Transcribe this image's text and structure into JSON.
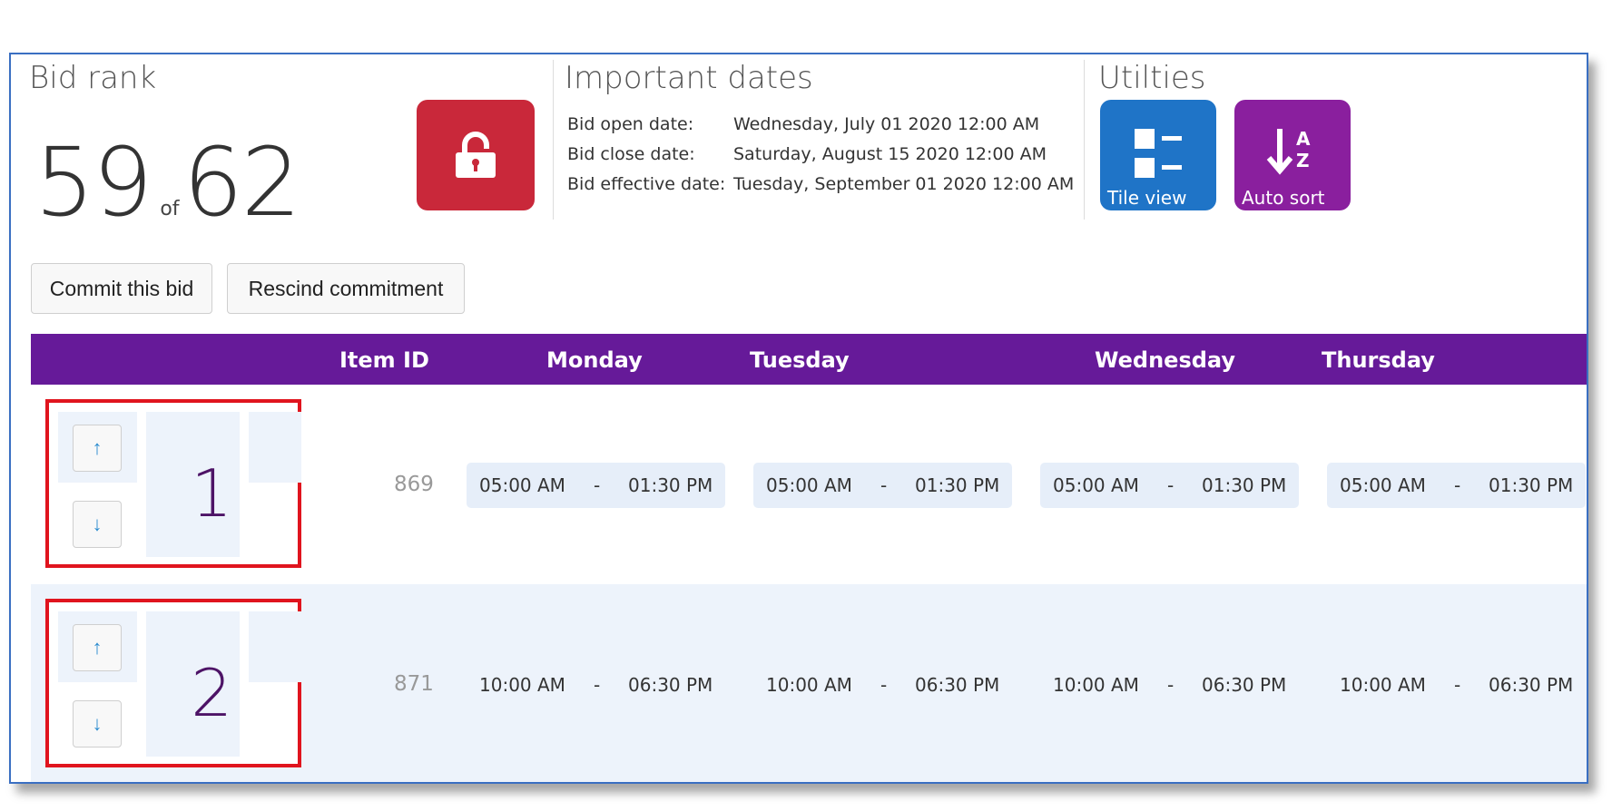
{
  "header": {
    "bid_rank": {
      "title": "Bid rank",
      "rank": "59",
      "of": "of",
      "total": "62"
    },
    "important_dates": {
      "title": "Important dates",
      "items": [
        {
          "label": "Bid open date:",
          "value": "Wednesday, July 01 2020 12:00 AM"
        },
        {
          "label": "Bid close date:",
          "value": "Saturday, August 15 2020 12:00 AM"
        },
        {
          "label": "Bid effective date:",
          "value": "Tuesday, September 01 2020 12:00 AM"
        }
      ]
    },
    "utilities": {
      "title": "Utilties",
      "tile_view": "Tile view",
      "auto_sort": "Auto sort",
      "sort_glyph_a": "A",
      "sort_glyph_z": "Z"
    }
  },
  "actions": {
    "commit": "Commit this bid",
    "rescind": "Rescind commitment"
  },
  "table": {
    "columns": [
      "Item ID",
      "Monday",
      "Tuesday",
      "Wednesday",
      "Thursday"
    ],
    "separator": "-",
    "rows": [
      {
        "rank": "1",
        "item_id": "869",
        "shifts": [
          {
            "start": "05:00 AM",
            "end": "01:30 PM"
          },
          {
            "start": "05:00 AM",
            "end": "01:30 PM"
          },
          {
            "start": "05:00 AM",
            "end": "01:30 PM"
          },
          {
            "start": "05:00 AM",
            "end": "01:30 PM"
          }
        ]
      },
      {
        "rank": "2",
        "item_id": "871",
        "shifts": [
          {
            "start": "10:00 AM",
            "end": "06:30 PM"
          },
          {
            "start": "10:00 AM",
            "end": "06:30 PM"
          },
          {
            "start": "10:00 AM",
            "end": "06:30 PM"
          },
          {
            "start": "10:00 AM",
            "end": "06:30 PM"
          }
        ]
      }
    ]
  },
  "icons": {
    "lock": "lock-icon",
    "tile": "tile-view-icon",
    "sort": "sort-az-icon",
    "up": "arrow-up-icon",
    "down": "arrow-down-icon"
  },
  "colors": {
    "lock_button": "#c9283a",
    "tile_button": "#1f74c7",
    "sort_button": "#8a1f9e",
    "table_header": "#661a99",
    "highlight_border": "#e0141e",
    "row_alt": "#edf3fb"
  }
}
